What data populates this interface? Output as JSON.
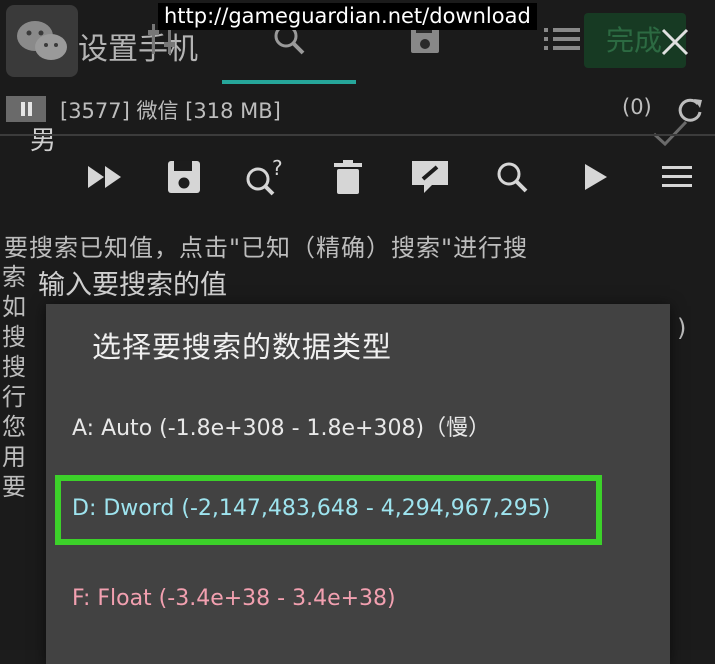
{
  "background": {
    "title": "设置手机",
    "done_label": "完成",
    "gender_male": "男",
    "info_text": "要搜索已知值，点击\"已知（精确）搜索\"进行搜",
    "side_chars": [
      "索",
      "如",
      "搜",
      "搜",
      "行",
      "您",
      "用",
      "要"
    ],
    "right_paren": ")"
  },
  "gg": {
    "url_overlay": "http://gameguardian.net/download",
    "process_text": "[3577] 微信 [318 MB]",
    "count": "(0)",
    "accent": "#26a69a",
    "toolbar_icons": [
      "fast-forward-icon",
      "save-icon",
      "search-question-icon",
      "delete-icon",
      "edit-icon",
      "search-icon",
      "play-icon",
      "menu-icon"
    ]
  },
  "input_label": "输入要搜索的值",
  "dialog": {
    "title": "选择要搜索的数据类型",
    "options": [
      {
        "label": "A: Auto (-1.8e+308 - 1.8e+308)（慢）",
        "color": "#e8e8e8"
      },
      {
        "label": "D: Dword (-2,147,483,648 - 4,294,967,295)",
        "color": "#9ee4ef",
        "highlighted": true
      },
      {
        "label": "F: Float (-3.4e+38 - 3.4e+38)",
        "color": "#f2a0b0"
      }
    ],
    "highlight_color": "#3cd12a"
  }
}
